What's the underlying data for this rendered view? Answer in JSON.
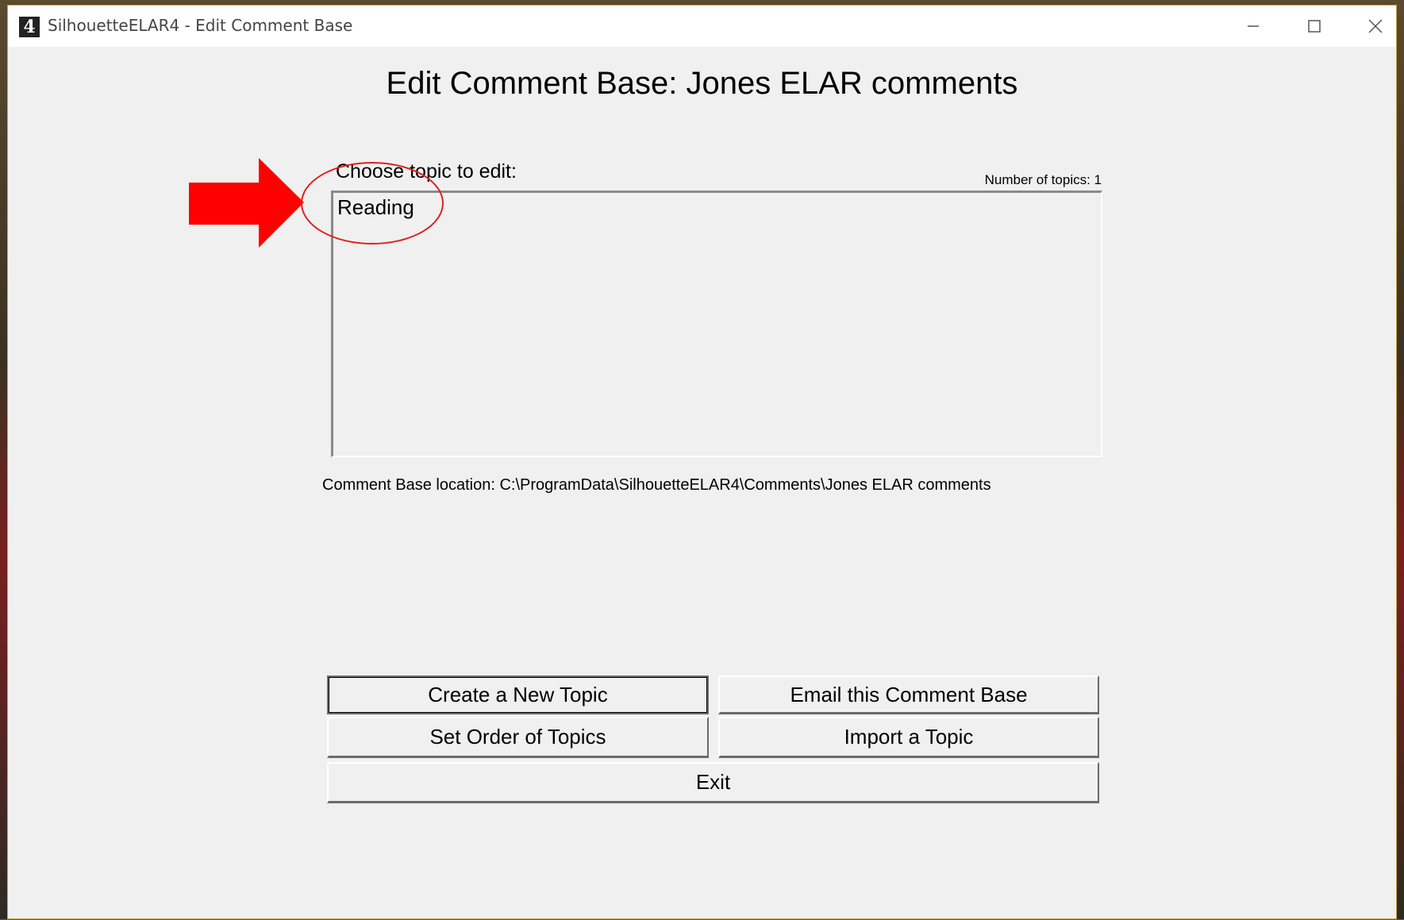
{
  "window": {
    "title": "SilhouetteELAR4 - Edit Comment Base",
    "icon_glyph": "4",
    "icon_name": "app-icon"
  },
  "heading": "Edit Comment Base: Jones ELAR comments",
  "topics": {
    "label": "Choose topic to edit:",
    "count_text": "Number of topics: 1",
    "items": [
      "Reading"
    ]
  },
  "location_text": "Comment Base location: C:\\ProgramData\\SilhouetteELAR4\\Comments\\Jones ELAR comments",
  "buttons": {
    "create_topic": "Create a New Topic",
    "email_base": "Email this Comment Base",
    "set_order": "Set Order of Topics",
    "import_topic": "Import a Topic",
    "exit": "Exit"
  },
  "annotation": {
    "arrow_color": "#ff0000",
    "circle_color": "#e02020"
  }
}
